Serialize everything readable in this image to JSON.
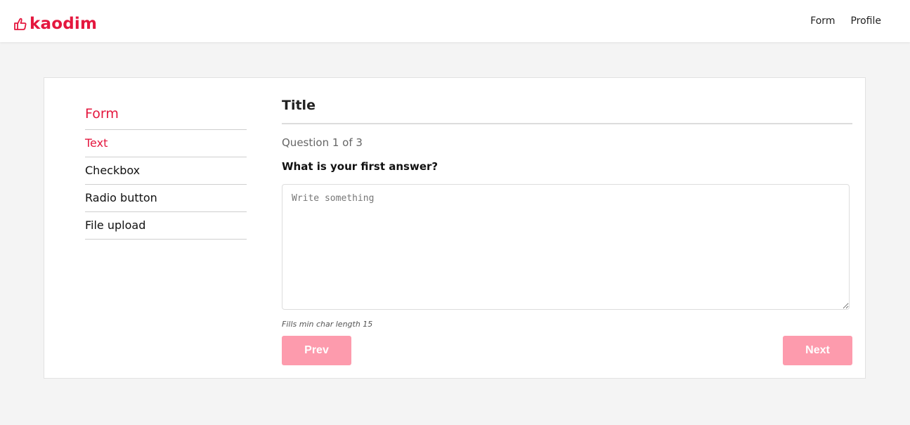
{
  "brand": {
    "name": "kaodim",
    "color": "#e4173e",
    "icon": "thumbs-up-hand-icon"
  },
  "nav": {
    "items": [
      "Form",
      "Profile"
    ]
  },
  "sidebar": {
    "title": "Form",
    "items": [
      {
        "label": "Text",
        "active": true
      },
      {
        "label": "Checkbox",
        "active": false
      },
      {
        "label": "Radio button",
        "active": false
      },
      {
        "label": "File upload",
        "active": false
      }
    ]
  },
  "main": {
    "title": "Title",
    "progress": "Question 1 of 3",
    "question": "What is your first answer?",
    "answer": {
      "value": "",
      "placeholder": "Write something"
    },
    "hint": "Fills min char length 15",
    "prev_label": "Prev",
    "next_label": "Next",
    "button_color": "#fd9bad"
  }
}
